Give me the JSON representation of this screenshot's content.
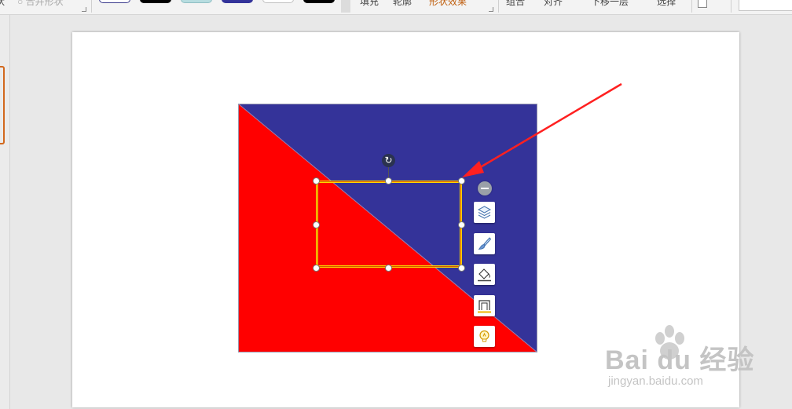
{
  "ribbon": {
    "left_cut_text": "状",
    "merge_shape_label": "○ 合并形状",
    "fill_label": "填充",
    "outline_label": "轮廓",
    "shape_effect_label": "形状效果",
    "group_label": "组合",
    "align_label": "对齐",
    "move_down_label": "下移一层",
    "select_label": "选择",
    "style_swatches": [
      {
        "fill": "#ffffff",
        "border": "#3a3a8c"
      },
      {
        "fill": "#000000",
        "border": "#000000"
      },
      {
        "fill": "#b7dde0",
        "border": "#8fbfc4"
      },
      {
        "fill": "#33339a",
        "border": "#33339a"
      },
      {
        "fill": "#ffffff",
        "border": "#c0c0c0"
      },
      {
        "fill": "#000000",
        "border": "#000000"
      }
    ]
  },
  "slide": {
    "picture": {
      "top_right_color": "#343399",
      "bottom_left_color": "#ff0000"
    },
    "selected_shape": {
      "border_color": "#ffd700",
      "inner_line_color": "#d45a00"
    },
    "float_toolbar": {
      "buttons": [
        {
          "icon": "layers-icon"
        },
        {
          "icon": "brush-icon"
        },
        {
          "icon": "fill-bucket-icon"
        },
        {
          "icon": "outline-icon"
        },
        {
          "icon": "lightbulb-icon"
        }
      ]
    },
    "annotation_arrow_color": "#ff2020"
  },
  "watermark": {
    "main": "Bai du 经验",
    "sub": "jingyan.baidu.com"
  }
}
